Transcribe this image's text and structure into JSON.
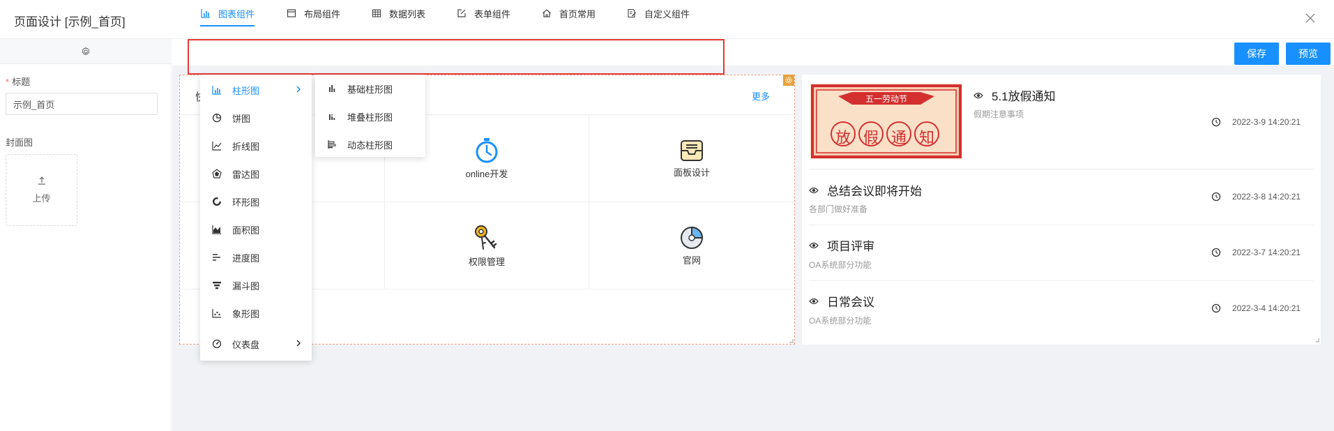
{
  "header": {
    "title": "页面设计 [示例_首页]"
  },
  "left_panel": {
    "title_label": "标题",
    "title_value": "示例_首页",
    "cover_label": "封面图",
    "upload_label": "上传"
  },
  "toolbar": {
    "tabs": [
      {
        "label": "图表组件",
        "icon": "bar-chart-icon",
        "active": true
      },
      {
        "label": "布局组件",
        "icon": "layout-icon"
      },
      {
        "label": "数据列表",
        "icon": "table-icon"
      },
      {
        "label": "表单组件",
        "icon": "edit-form-icon"
      },
      {
        "label": "首页常用",
        "icon": "home-icon"
      },
      {
        "label": "自定义组件",
        "icon": "custom-component-icon"
      }
    ],
    "save_label": "保存",
    "preview_label": "预览"
  },
  "chart_menu": {
    "items": [
      {
        "label": "柱形图",
        "icon": "bar-chart-icon",
        "has_submenu": true,
        "active": true
      },
      {
        "label": "饼图",
        "icon": "pie-chart-icon"
      },
      {
        "label": "折线图",
        "icon": "line-chart-icon"
      },
      {
        "label": "雷达图",
        "icon": "radar-chart-icon"
      },
      {
        "label": "环形图",
        "icon": "ring-chart-icon"
      },
      {
        "label": "面积图",
        "icon": "area-chart-icon"
      },
      {
        "label": "进度图",
        "icon": "progress-chart-icon"
      },
      {
        "label": "漏斗图",
        "icon": "funnel-chart-icon"
      },
      {
        "label": "象形图",
        "icon": "pictorial-chart-icon"
      },
      {
        "label": "仪表盘",
        "icon": "gauge-icon",
        "has_submenu": true
      }
    ],
    "submenu": [
      {
        "label": "基础柱形图",
        "icon": "basic-bar-icon"
      },
      {
        "label": "堆叠柱形图",
        "icon": "stacked-bar-icon"
      },
      {
        "label": "动态柱形图",
        "icon": "dynamic-bar-icon"
      }
    ]
  },
  "quick_nav": {
    "header_partial": "快",
    "more_label": "更多",
    "items": [
      {
        "label": "online开发",
        "icon": "stopwatch-icon"
      },
      {
        "label": "面板设计",
        "icon": "inbox-tray-icon"
      },
      {
        "label": "权限管理",
        "icon": "keys-icon"
      },
      {
        "label": "官网",
        "icon": "pie-globe-icon"
      }
    ]
  },
  "notices": [
    {
      "title": "5.1放假通知",
      "subtitle": "假期注意事项",
      "time": "2022-3-9 14:20:21",
      "banner_ribbon": "五一劳动节",
      "banner_chars": [
        "放",
        "假",
        "通",
        "知"
      ]
    },
    {
      "title": "总结会议即将开始",
      "subtitle": "各部门做好准备",
      "time": "2022-3-8 14:20:21"
    },
    {
      "title": "项目评审",
      "subtitle": "OA系统部分功能",
      "time": "2022-3-7 14:20:21"
    },
    {
      "title": "日常会议",
      "subtitle": "OA系统部分功能",
      "time": "2022-3-4 14:20:21"
    }
  ],
  "colors": {
    "primary": "#1890ff",
    "highlight": "#e53935",
    "required": "#f56c6c",
    "banner_red": "#d32f2f"
  }
}
